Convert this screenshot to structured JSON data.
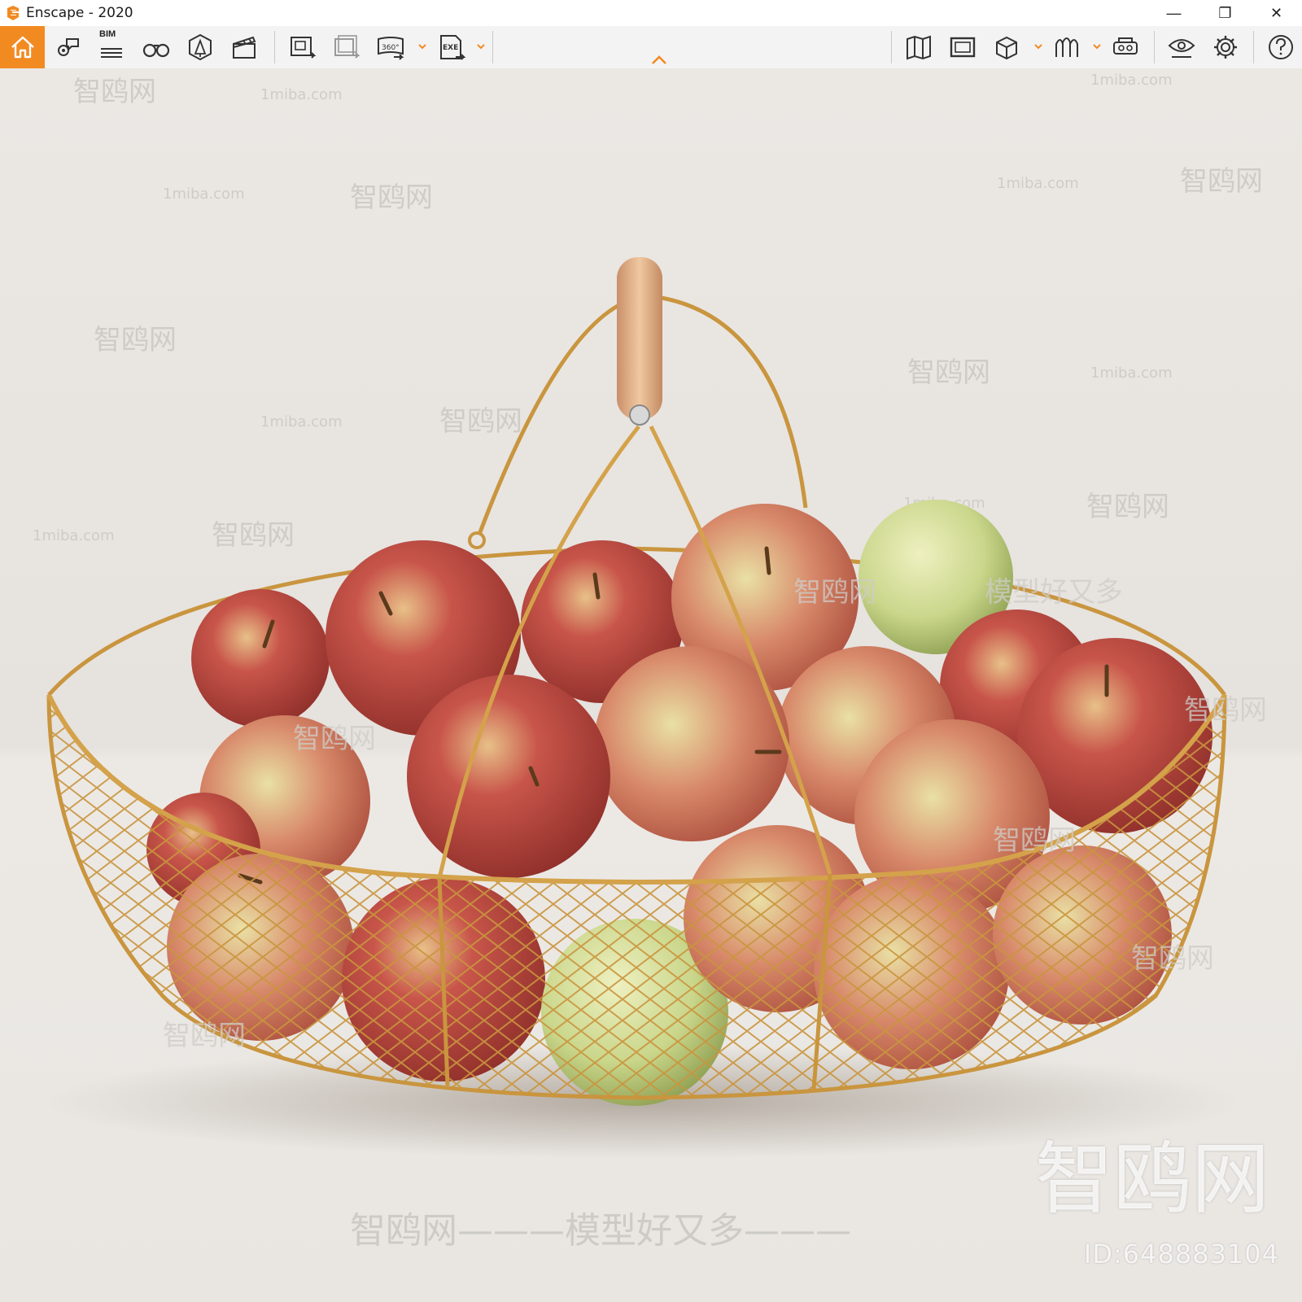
{
  "window": {
    "title": "Enscape - 2020",
    "controls": {
      "minimize": "—",
      "restore": "❐",
      "close": "✕"
    }
  },
  "toolbar": {
    "home_icon": "home-icon",
    "bim_label": "BIM",
    "panorama_label": "360°",
    "exe_label": "EXE",
    "accent_color": "#f28a22"
  },
  "watermarks": {
    "site": "1miba.com",
    "brand": "智鸥网",
    "bottom_line": "智鸥网———模型好又多———",
    "id_text": "ID:648883104"
  },
  "scene": {
    "description_icon": "apple-basket-render"
  }
}
